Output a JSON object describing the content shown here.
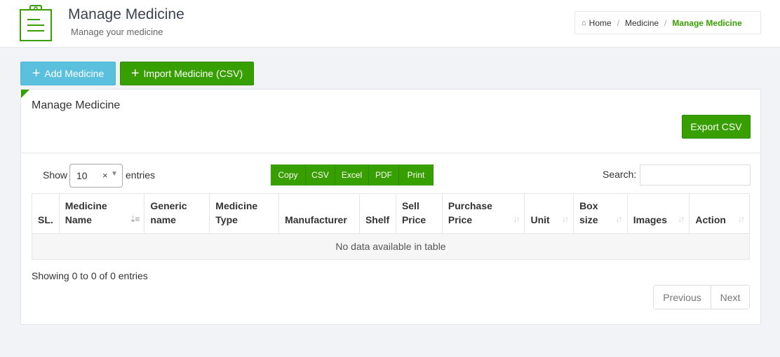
{
  "header": {
    "title": "Manage Medicine",
    "subtitle": "Manage your medicine",
    "icon": "clipboard-list-icon",
    "accent_color": "#37a000"
  },
  "breadcrumb": {
    "items": [
      "Home",
      "Medicine",
      "Manage Medicine"
    ]
  },
  "actions": {
    "add_label": "Add Medicine",
    "import_label": "Import Medicine (CSV)"
  },
  "panel": {
    "title": "Manage Medicine",
    "export_label": "Export CSV"
  },
  "table_controls": {
    "show_label": "Show",
    "entries_value": "10",
    "entries_label": "entries",
    "export_buttons": [
      "Copy",
      "CSV",
      "Excel",
      "PDF",
      "Print"
    ],
    "search_label": "Search:",
    "search_value": ""
  },
  "table": {
    "columns": [
      "SL.",
      "Medicine Name",
      "Generic name",
      "Medicine Type",
      "Manufacturer",
      "Shelf",
      "Sell Price",
      "Purchase Price",
      "Unit",
      "Box size",
      "Images",
      "Action"
    ],
    "empty_message": "No data available in table"
  },
  "footer": {
    "info": "Showing 0 to 0 of 0 entries",
    "previous_label": "Previous",
    "next_label": "Next"
  }
}
